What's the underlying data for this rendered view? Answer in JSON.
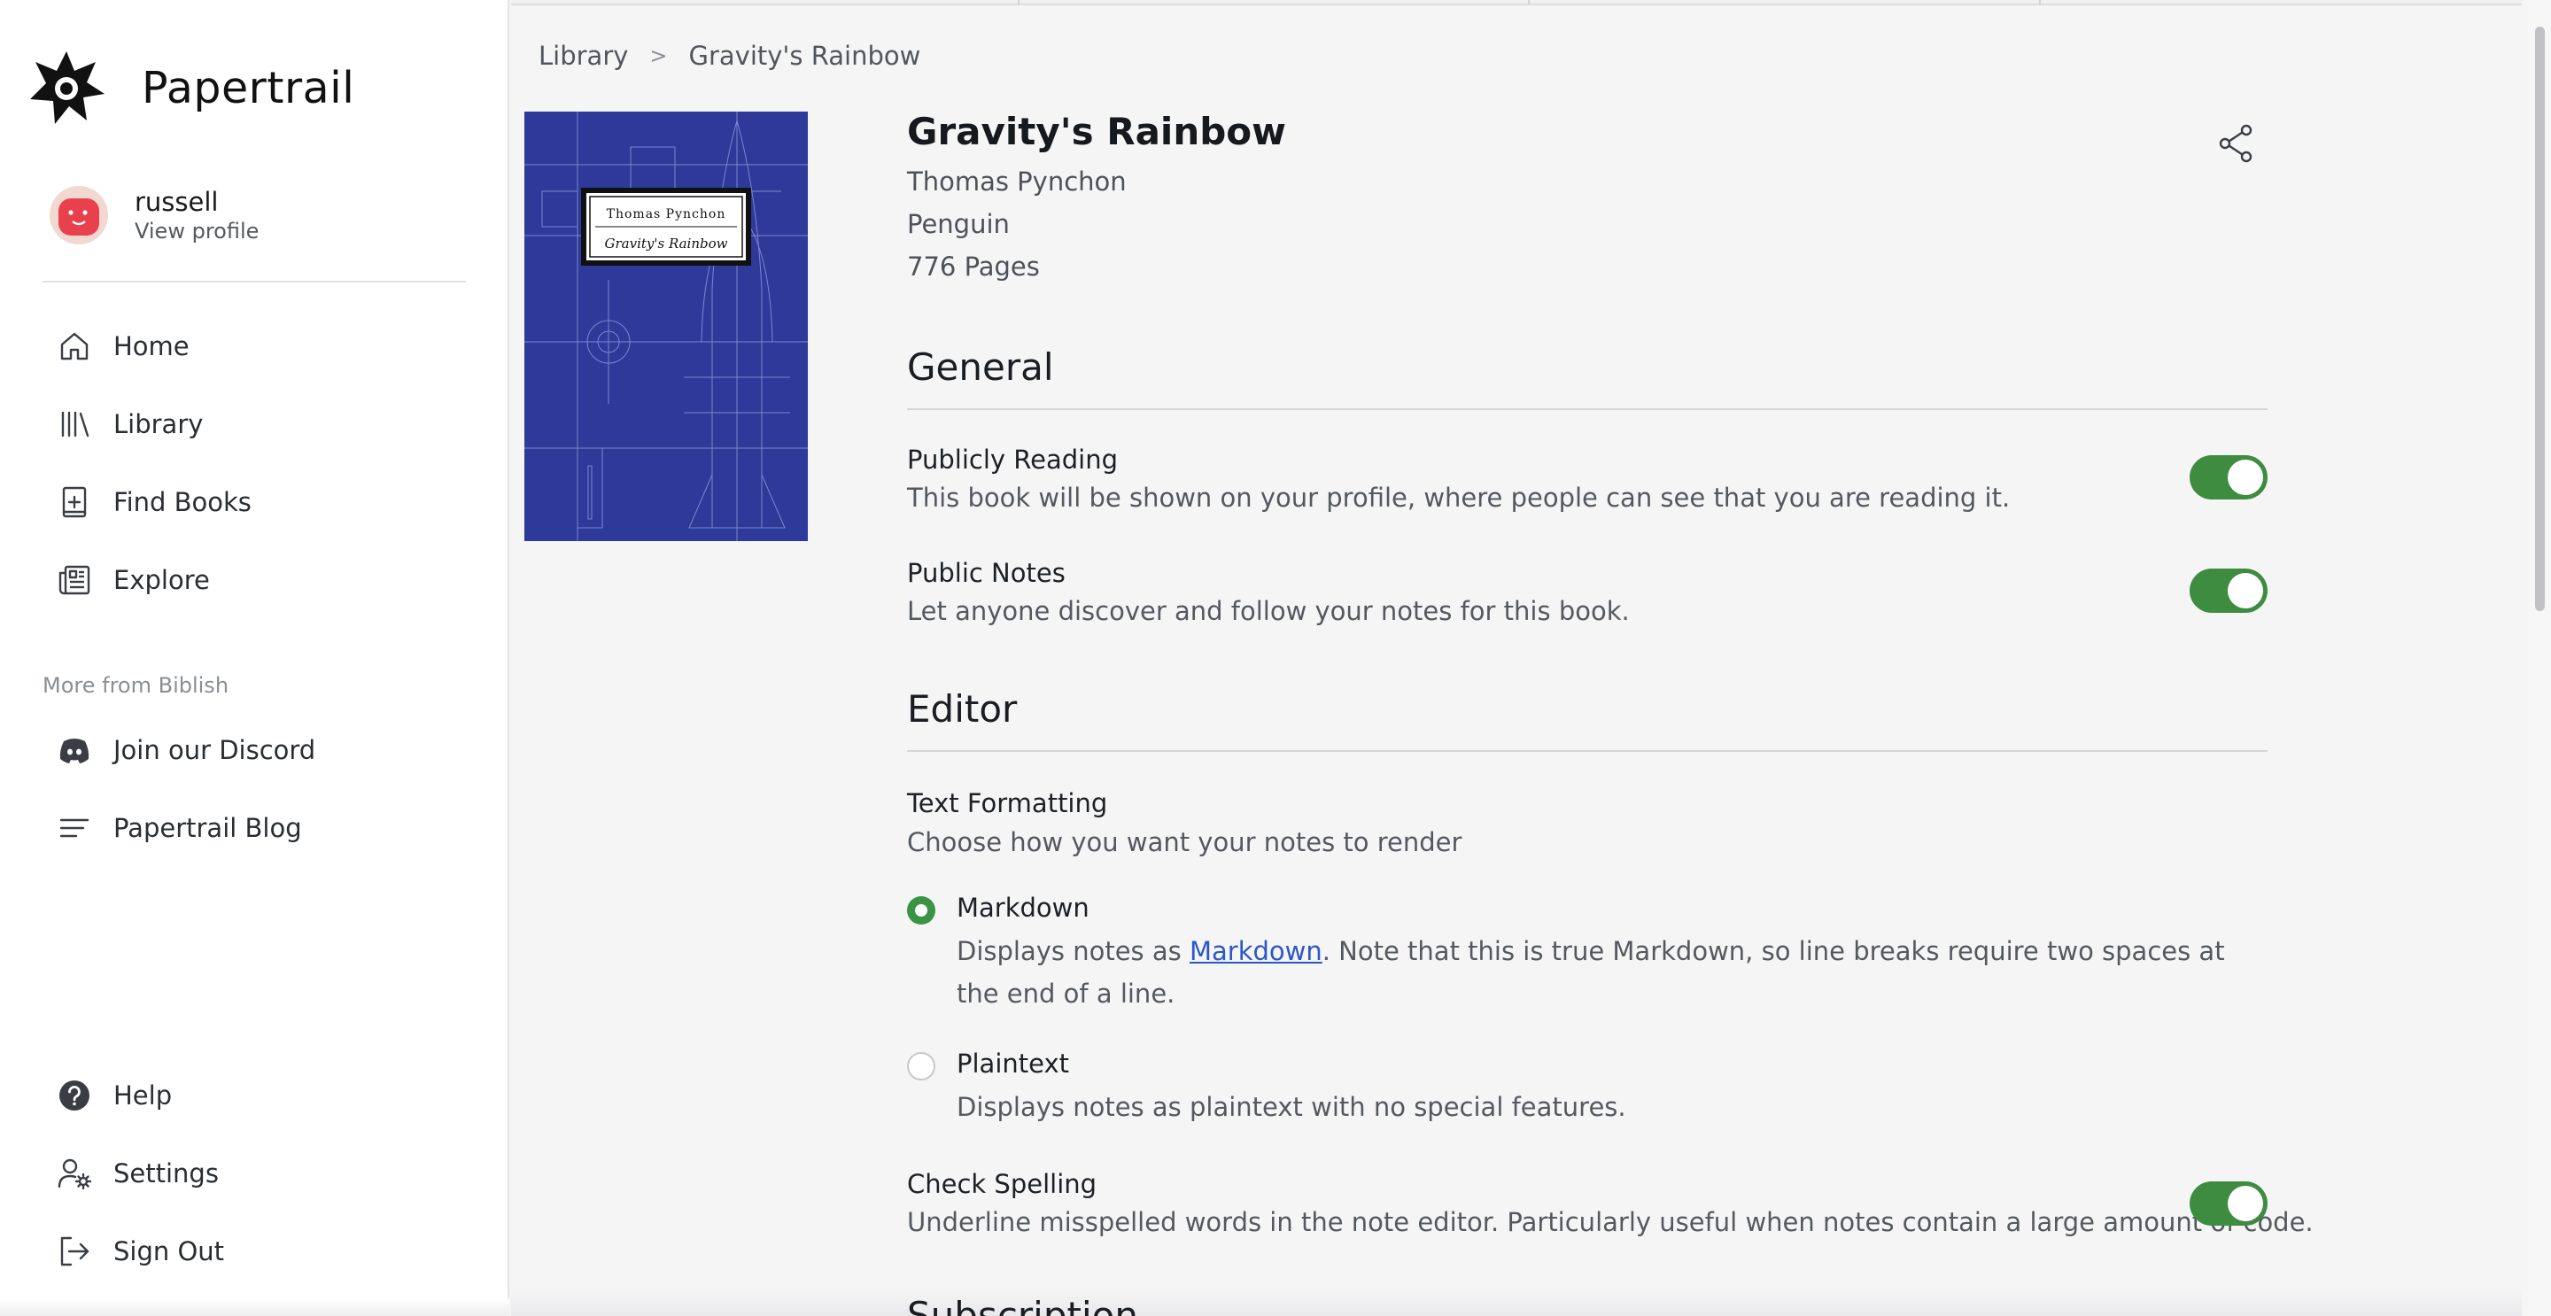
{
  "app": {
    "name": "Papertrail"
  },
  "user": {
    "name": "russell",
    "profile_link": "View profile"
  },
  "nav": {
    "main": [
      {
        "label": "Home",
        "icon": "home-icon"
      },
      {
        "label": "Library",
        "icon": "library-icon"
      },
      {
        "label": "Find Books",
        "icon": "find-books-icon"
      },
      {
        "label": "Explore",
        "icon": "explore-icon"
      }
    ],
    "more_label": "More from Biblish",
    "more": [
      {
        "label": "Join our Discord",
        "icon": "discord-icon"
      },
      {
        "label": "Papertrail Blog",
        "icon": "blog-icon"
      }
    ],
    "bottom": [
      {
        "label": "Help",
        "icon": "help-icon"
      },
      {
        "label": "Settings",
        "icon": "settings-icon"
      },
      {
        "label": "Sign Out",
        "icon": "sign-out-icon"
      }
    ]
  },
  "breadcrumb": {
    "root": "Library",
    "separator": ">",
    "current": "Gravity's Rainbow"
  },
  "book": {
    "title": "Gravity's Rainbow",
    "author": "Thomas Pynchon",
    "publisher": "Penguin",
    "pages": "776 Pages",
    "cover": {
      "author": "Thomas Pynchon",
      "title": "Gravity's Rainbow"
    }
  },
  "general": {
    "heading": "General",
    "publicly_reading": {
      "title": "Publicly Reading",
      "desc": "This book will be shown on your profile, where people can see that you are reading it.",
      "enabled": true
    },
    "public_notes": {
      "title": "Public Notes",
      "desc": "Let anyone discover and follow your notes for this book.",
      "enabled": true
    }
  },
  "editor": {
    "heading": "Editor",
    "text_formatting": {
      "title": "Text Formatting",
      "desc": "Choose how you want your notes to render",
      "options": [
        {
          "label": "Markdown",
          "selected": true,
          "desc_before": "Displays notes as ",
          "link": "Markdown",
          "desc_after": ". Note that this is true Markdown, so line breaks require two spaces at the end of a line."
        },
        {
          "label": "Plaintext",
          "selected": false,
          "desc": "Displays notes as plaintext with no special features."
        }
      ]
    },
    "check_spelling": {
      "title": "Check Spelling",
      "desc": "Underline misspelled words in the note editor. Particularly useful when notes contain a large amount of code.",
      "enabled": true
    }
  },
  "next_section_heading": "Subscription",
  "colors": {
    "accent_green": "#3d8c40",
    "link_blue": "#2c57c7",
    "cover_blue": "#2d3a9a",
    "avatar_red": "#e8414d"
  }
}
